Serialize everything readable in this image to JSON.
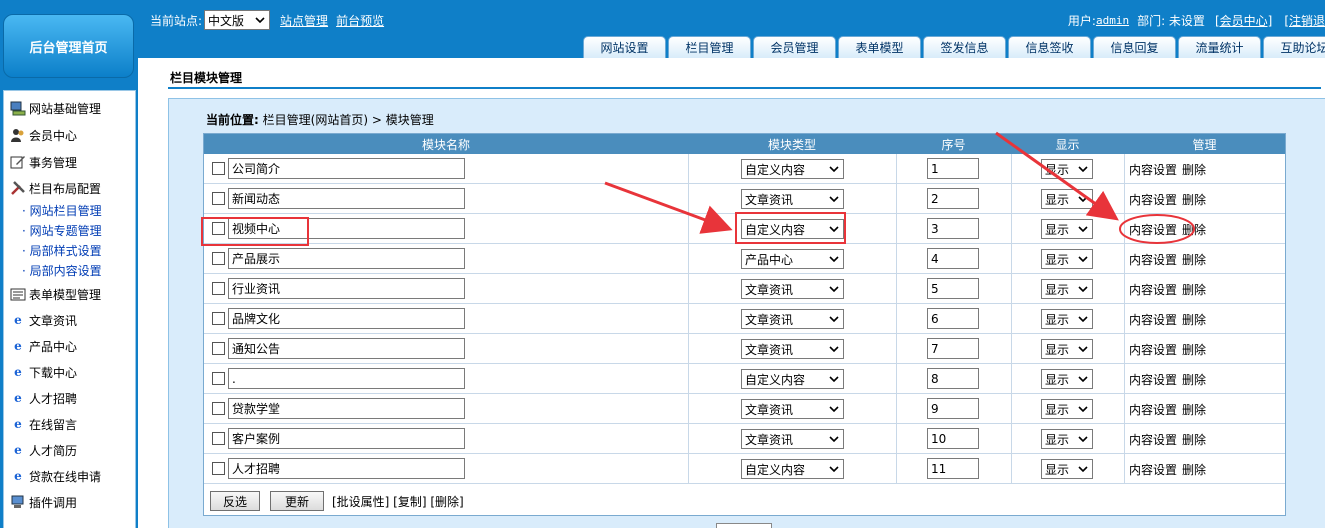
{
  "sidebar": {
    "home_label": "后台管理首页",
    "items": [
      {
        "label": "网站基础管理",
        "icon": "computer-icon"
      },
      {
        "label": "会员中心",
        "icon": "users-icon"
      },
      {
        "label": "事务管理",
        "icon": "edit-icon"
      },
      {
        "label": "栏目布局配置",
        "icon": "tools-icon"
      }
    ],
    "sub_items": [
      {
        "label": "· 网站栏目管理"
      },
      {
        "label": "· 网站专题管理"
      },
      {
        "label": "· 局部样式设置"
      },
      {
        "label": "· 局部内容设置"
      }
    ],
    "items2": [
      {
        "label": "表单模型管理",
        "icon": "form-icon"
      },
      {
        "label": "文章资讯",
        "icon": "ie-icon"
      },
      {
        "label": "产品中心",
        "icon": "ie-icon"
      },
      {
        "label": "下载中心",
        "icon": "ie-icon"
      },
      {
        "label": "人才招聘",
        "icon": "ie-icon"
      },
      {
        "label": "在线留言",
        "icon": "ie-icon"
      },
      {
        "label": "人才简历",
        "icon": "ie-icon"
      },
      {
        "label": "贷款在线申请",
        "icon": "ie-icon"
      },
      {
        "label": "插件调用",
        "icon": "monitor-icon"
      }
    ]
  },
  "header": {
    "site_label": "当前站点:",
    "site_value": "中文版",
    "site_manage": "站点管理",
    "preview": "前台预览",
    "user_label": "用户:",
    "user_name": "admin",
    "dept_label": "部门: 未设置",
    "member_center": "[会员中心]",
    "logout": "[注销退",
    "tabs": [
      "网站设置",
      "栏目管理",
      "会员管理",
      "表单模型",
      "签发信息",
      "信息签收",
      "信息回复",
      "流量统计",
      "互助论坛"
    ]
  },
  "main": {
    "title": "栏目模块管理",
    "crumb_label": "当前位置:",
    "crumb_path": "栏目管理(网站首页) > 模块管理",
    "columns": [
      "模块名称",
      "模块类型",
      "序号",
      "显示",
      "管理"
    ],
    "rows": [
      {
        "name": "公司简介",
        "type": "自定义内容",
        "seq": "1",
        "show": "显示"
      },
      {
        "name": "新闻动态",
        "type": "文章资讯",
        "seq": "2",
        "show": "显示"
      },
      {
        "name": "视频中心",
        "type": "自定义内容",
        "seq": "3",
        "show": "显示"
      },
      {
        "name": "产品展示",
        "type": "产品中心",
        "seq": "4",
        "show": "显示"
      },
      {
        "name": "行业资讯",
        "type": "文章资讯",
        "seq": "5",
        "show": "显示"
      },
      {
        "name": "品牌文化",
        "type": "文章资讯",
        "seq": "6",
        "show": "显示"
      },
      {
        "name": "通知公告",
        "type": "文章资讯",
        "seq": "7",
        "show": "显示"
      },
      {
        "name": ".",
        "type": "自定义内容",
        "seq": "8",
        "show": "显示"
      },
      {
        "name": "贷款学堂",
        "type": "文章资讯",
        "seq": "9",
        "show": "显示"
      },
      {
        "name": "客户案例",
        "type": "文章资讯",
        "seq": "10",
        "show": "显示"
      },
      {
        "name": "人才招聘",
        "type": "自定义内容",
        "seq": "11",
        "show": "显示"
      }
    ],
    "content_setting": "内容设置",
    "delete": "删除",
    "invert_button": "反选",
    "update_button": "更新",
    "batch_text": "[批设属性] [复制] [删除]"
  },
  "colors": {
    "accent": "#0f7fc8",
    "panel": "#d9ecfb",
    "header_row": "#4a8dbd",
    "annotation": "#e8343a"
  }
}
